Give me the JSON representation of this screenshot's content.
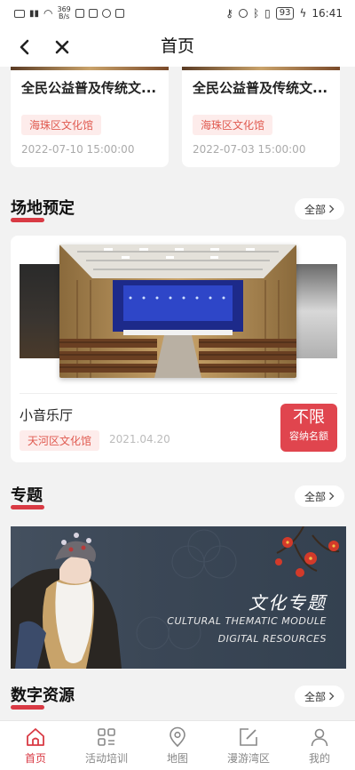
{
  "status_bar": {
    "net_speed_value": "369",
    "net_speed_unit": "B/s",
    "battery": "93",
    "time": "16:41"
  },
  "nav": {
    "title": "首页"
  },
  "top_cards": [
    {
      "title": "全民公益普及传统文...",
      "tag": "海珠区文化馆",
      "date": "2022-07-10 15:00:00"
    },
    {
      "title": "全民公益普及传统文...",
      "tag": "海珠区文化馆",
      "date": "2022-07-03 15:00:00"
    }
  ],
  "venue_section": {
    "title": "场地预定",
    "more_label": "全部",
    "venue": {
      "name": "小音乐厅",
      "tag": "天河区文化馆",
      "date": "2021.04.20",
      "capacity_big": "不限",
      "capacity_small": "容纳名额"
    }
  },
  "topic_section": {
    "title": "专题",
    "more_label": "全部",
    "banner": {
      "title_cn": "文化专题",
      "line1": "CULTURAL THEMATIC MODULE",
      "line2": "DIGITAL RESOURCES"
    }
  },
  "digital_section": {
    "title": "数字资源",
    "more_label": "全部"
  },
  "tabs": [
    {
      "label": "首页",
      "icon": "home-icon",
      "active": true
    },
    {
      "label": "活动培训",
      "icon": "grid-icon",
      "active": false
    },
    {
      "label": "地图",
      "icon": "map-pin-icon",
      "active": false
    },
    {
      "label": "漫游湾区",
      "icon": "edit-icon",
      "active": false
    },
    {
      "label": "我的",
      "icon": "user-icon",
      "active": false
    }
  ],
  "colors": {
    "accent": "#d93a44",
    "tag_bg": "#fdeceb",
    "tag_text": "#e05a50",
    "page_bg": "#f2f2f2"
  }
}
